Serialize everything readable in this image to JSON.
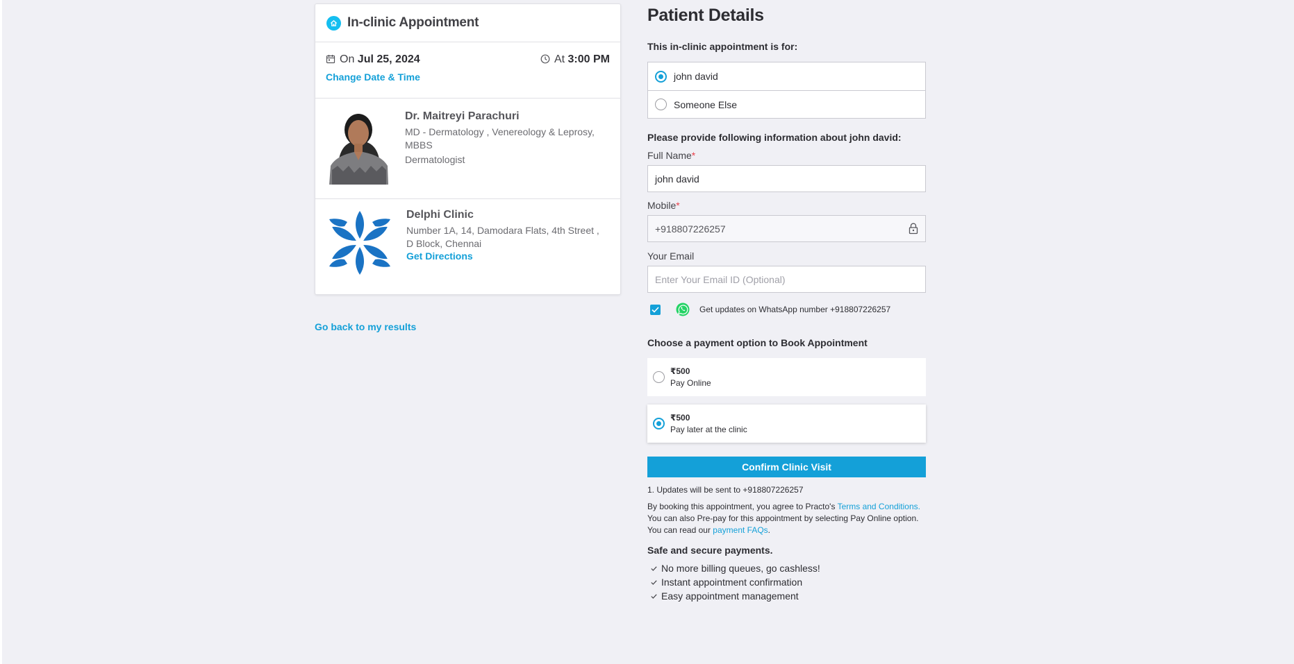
{
  "appointment_card": {
    "title": "In-clinic Appointment",
    "date_prefix": "On",
    "date": "Jul 25, 2024",
    "time_prefix": "At",
    "time": "3:00 PM",
    "change_link": "Change Date & Time"
  },
  "doctor": {
    "name": "Dr. Maitreyi Parachuri",
    "qualification_line1": "MD - Dermatology , Venereology & Leprosy,",
    "qualification_line2": "MBBS",
    "specialty": "Dermatologist"
  },
  "clinic": {
    "name": "Delphi Clinic",
    "address_line1": "Number 1A, 14, Damodara Flats, 4th Street ,",
    "address_line2": "D Block, Chennai",
    "directions_link": "Get Directions"
  },
  "back_link": "Go back to my results",
  "patient": {
    "title": "Patient Details",
    "for_label": "This in-clinic appointment is for:",
    "options": [
      {
        "label": "john david",
        "selected": true
      },
      {
        "label": "Someone Else",
        "selected": false
      }
    ],
    "provide_label": "Please provide following information about john david:",
    "full_name_label": "Full Name",
    "full_name_value": "john david",
    "mobile_label": "Mobile",
    "mobile_value": "+918807226257",
    "email_label": "Your Email",
    "email_placeholder": "Enter Your Email ID (Optional)",
    "required_mark": "*",
    "whatsapp_text": "Get updates on WhatsApp number +918807226257"
  },
  "payment": {
    "heading": "Choose a payment option to Book Appointment",
    "options": [
      {
        "amount": "₹500",
        "label": "Pay Online",
        "selected": false
      },
      {
        "amount": "₹500",
        "label": "Pay later at the clinic",
        "selected": true
      }
    ],
    "confirm_button": "Confirm Clinic Visit",
    "note": "1.  Updates will be sent to +918807226257",
    "terms_text1": "By booking this appointment, you agree to Practo's ",
    "terms_link": "Terms and Conditions.",
    "terms_text2": "You can also Pre-pay for this appointment by selecting Pay Online option.",
    "terms_text3": "You can read our ",
    "faq_link": "payment FAQs",
    "terms_text4": "."
  },
  "secure": {
    "heading": "Safe and secure payments.",
    "items": [
      "No more billing queues, go cashless!",
      "Instant appointment confirmation",
      "Easy appointment management"
    ]
  },
  "colors": {
    "accent": "#14a0d8",
    "background": "#f0f0f5",
    "whatsapp": "#25d366",
    "clinic_logo": "#1a73c4"
  },
  "icons": [
    "home-icon",
    "calendar-icon",
    "clock-icon",
    "lock-icon",
    "whatsapp-icon",
    "check-icon"
  ]
}
